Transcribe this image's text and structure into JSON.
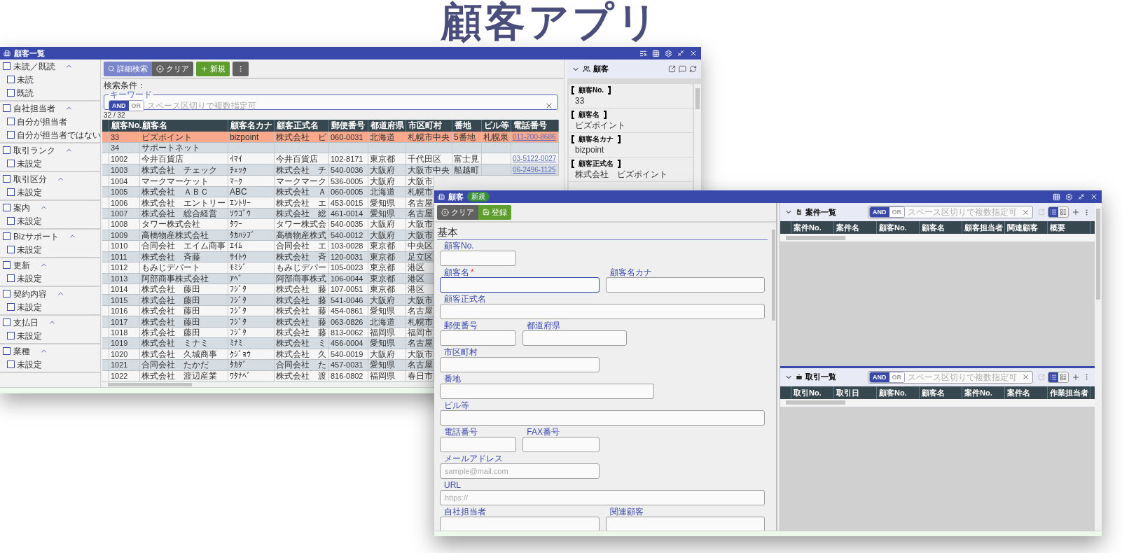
{
  "app_title": "顧客アプリ",
  "list_window": {
    "title": "顧客一覧",
    "filters": [
      {
        "label": "未読／既読",
        "checked": false,
        "expanded": true,
        "children": [
          {
            "label": "未読",
            "checked": false
          },
          {
            "label": "既読",
            "checked": false
          }
        ]
      },
      {
        "label": "自社担当者",
        "checked": false,
        "expanded": true,
        "children": [
          {
            "label": "自分が担当者",
            "checked": false
          },
          {
            "label": "自分が担当者ではない",
            "checked": false
          }
        ]
      },
      {
        "label": "取引ランク",
        "checked": false,
        "expanded": true,
        "children": [
          {
            "label": "未設定",
            "checked": false
          }
        ]
      },
      {
        "label": "取引区分",
        "checked": false,
        "expanded": true,
        "children": [
          {
            "label": "未設定",
            "checked": false
          }
        ]
      },
      {
        "label": "案内",
        "checked": false,
        "expanded": true,
        "children": [
          {
            "label": "未設定",
            "checked": false
          }
        ]
      },
      {
        "label": "Bizサポート",
        "checked": false,
        "expanded": true,
        "children": [
          {
            "label": "未設定",
            "checked": false
          }
        ]
      },
      {
        "label": "更新",
        "checked": false,
        "expanded": true,
        "children": [
          {
            "label": "未設定",
            "checked": false
          }
        ]
      },
      {
        "label": "契約内容",
        "checked": false,
        "expanded": true,
        "children": [
          {
            "label": "未設定",
            "checked": false
          }
        ]
      },
      {
        "label": "支払日",
        "checked": false,
        "expanded": true,
        "children": [
          {
            "label": "未設定",
            "checked": false
          }
        ]
      },
      {
        "label": "業種",
        "checked": false,
        "expanded": true,
        "children": [
          {
            "label": "未設定",
            "checked": false
          }
        ]
      }
    ],
    "toolbar": [
      {
        "kind": "search",
        "label": "詳細検索"
      },
      {
        "kind": "clear",
        "label": "クリア"
      },
      {
        "kind": "new",
        "label": "新規"
      },
      {
        "kind": "more"
      }
    ],
    "search_caption": "検索条件：",
    "keyword": {
      "legend": "キーワード",
      "modes": [
        {
          "label": "AND",
          "selected": true
        },
        {
          "label": "OR",
          "selected": false
        }
      ],
      "placeholder": "スペース区切りで複数指定可"
    },
    "count": "32 / 32",
    "table": {
      "columns": [
        "顧客No.",
        "顧客名",
        "顧客名カナ",
        "顧客正式名",
        "郵便番号",
        "都道府県",
        "市区町村",
        "番地",
        "ビル等",
        "電話番号"
      ],
      "rows": [
        {
          "selected": true,
          "cells": [
            "33",
            "ビズポイント",
            "bizpoint",
            "株式会社　ビ",
            "060-0031",
            "北海道",
            "札幌市中央",
            "5番地",
            "札幌泉",
            "011-200-8686"
          ]
        },
        {
          "selected": false,
          "cells": [
            "34",
            "サポートネット"
          ]
        },
        {
          "selected": false,
          "cells": [
            "1002",
            "今井百貨店",
            "ｲﾏｲ",
            "今井百貨店",
            "102-8171",
            "東京都",
            "千代田区",
            "富士見",
            null,
            "03-5122-0027"
          ]
        },
        {
          "selected": false,
          "cells": [
            "1003",
            "株式会社　チェック",
            "ﾁｪｯｸ",
            "株式会社　チ",
            "540-0036",
            "大阪府",
            "大阪市中央",
            "船越町",
            null,
            "06-2496-1125"
          ]
        },
        {
          "selected": false,
          "cells": [
            "1004",
            "マークマーケット",
            "ﾏｰｸ",
            "マークマーク",
            "536-0005",
            "大阪府",
            "大阪市"
          ]
        },
        {
          "selected": false,
          "cells": [
            "1005",
            "株式会社　ＡＢＣ",
            "ABC",
            "株式会社　Ａ",
            "060-0005",
            "北海道",
            "札幌市"
          ]
        },
        {
          "selected": false,
          "cells": [
            "1006",
            "株式会社　エントリー",
            "ｴﾝﾄﾘｰ",
            "株式会社　エ",
            "453-0015",
            "愛知県",
            "名古屋"
          ]
        },
        {
          "selected": false,
          "cells": [
            "1007",
            "株式会社　総合経営",
            "ｿｳｺﾞｳ",
            "株式会社　総",
            "461-0014",
            "愛知県",
            "名古屋"
          ]
        },
        {
          "selected": false,
          "cells": [
            "1008",
            "タワー株式会社",
            "ﾀﾜｰ",
            "タワー株式会",
            "540-0035",
            "大阪府",
            "大阪市"
          ]
        },
        {
          "selected": false,
          "cells": [
            "1009",
            "高橋物産株式会社",
            "ﾀｶﾊｼﾌﾞ",
            "高橋物産株式",
            "540-0012",
            "大阪府",
            "大阪市"
          ]
        },
        {
          "selected": false,
          "cells": [
            "1010",
            "合同会社　エイム商事",
            "ｴｲﾑ",
            "合同会社　エ",
            "103-0028",
            "東京都",
            "中央区"
          ]
        },
        {
          "selected": false,
          "cells": [
            "1011",
            "株式会社　斉藤",
            "ｻｲﾄｳ",
            "株式会社　斉",
            "120-0031",
            "東京都",
            "足立区"
          ]
        },
        {
          "selected": false,
          "cells": [
            "1012",
            "もみじデパート",
            "ﾓﾐｼﾞ",
            "もみじデパー",
            "105-0023",
            "東京都",
            "港区"
          ]
        },
        {
          "selected": false,
          "cells": [
            "1013",
            "阿部商事株式会社",
            "ｱﾍﾞ",
            "阿部商事株式",
            "106-0044",
            "東京都",
            "港区"
          ]
        },
        {
          "selected": false,
          "cells": [
            "1014",
            "株式会社　藤田",
            "ﾌｼﾞﾀ",
            "株式会社　藤",
            "107-0051",
            "東京都",
            "港区"
          ]
        },
        {
          "selected": false,
          "cells": [
            "1015",
            "株式会社　藤田",
            "ﾌｼﾞﾀ",
            "株式会社　藤",
            "541-0046",
            "大阪府",
            "大阪市"
          ]
        },
        {
          "selected": false,
          "cells": [
            "1016",
            "株式会社　藤田",
            "ﾌｼﾞﾀ",
            "株式会社　藤",
            "454-0861",
            "愛知県",
            "名古屋"
          ]
        },
        {
          "selected": false,
          "cells": [
            "1017",
            "株式会社　藤田",
            "ﾌｼﾞﾀ",
            "株式会社　藤",
            "063-0826",
            "北海道",
            "札幌市"
          ]
        },
        {
          "selected": false,
          "cells": [
            "1018",
            "株式会社　藤田",
            "ﾌｼﾞﾀ",
            "株式会社　藤",
            "813-0062",
            "福岡県",
            "福岡市"
          ]
        },
        {
          "selected": false,
          "cells": [
            "1019",
            "株式会社　ミナミ",
            "ﾐﾅﾐ",
            "株式会社　ミ",
            "456-0004",
            "愛知県",
            "名古屋"
          ]
        },
        {
          "selected": false,
          "cells": [
            "1020",
            "株式会社　久城商事",
            "ｸｼﾞｮｳ",
            "株式会社　久",
            "540-0019",
            "大阪府",
            "大阪市"
          ]
        },
        {
          "selected": false,
          "cells": [
            "1021",
            "合同会社　たかだ",
            "ﾀｶﾀﾞ",
            "合同会社　た",
            "457-0031",
            "愛知県",
            "名古屋"
          ]
        },
        {
          "selected": false,
          "cells": [
            "1022",
            "株式会社　渡辺産業",
            "ﾜﾀﾅﾍﾞ",
            "株式会社　渡",
            "816-0802",
            "福岡県",
            "春日市"
          ]
        }
      ]
    },
    "detail": {
      "title": "顧客",
      "expanded": true,
      "fields": [
        {
          "label": "顧客No.",
          "value": "33"
        },
        {
          "label": "顧客名",
          "value": "ビズポイント"
        },
        {
          "label": "顧客名カナ",
          "value": "bizpoint"
        },
        {
          "label": "顧客正式名",
          "value": "株式会社　ビズポイント"
        }
      ]
    }
  },
  "form_window": {
    "title": "顧客",
    "badge": "新規",
    "toolbar": [
      {
        "kind": "clear",
        "label": "クリア"
      },
      {
        "kind": "save",
        "label": "登録"
      }
    ],
    "section": "基本",
    "rows": [
      [
        {
          "label": "顧客No.",
          "focused": false
        }
      ],
      [
        {
          "label": "顧客名",
          "mark": "*",
          "focused": true
        },
        {
          "label": "顧客名カナ",
          "focused": false
        }
      ],
      [
        {
          "label": "顧客正式名",
          "focused": false
        }
      ],
      [
        {
          "label": "郵便番号",
          "focused": false
        },
        {
          "label": "都道府県",
          "focused": false
        }
      ],
      [
        {
          "label": "市区町村",
          "focused": false
        }
      ],
      [
        {
          "label": "番地",
          "focused": false
        }
      ],
      [
        {
          "label": "ビル等",
          "focused": false
        }
      ],
      [
        {
          "label": "電話番号",
          "focused": false
        },
        {
          "label": "FAX番号",
          "focused": false
        }
      ],
      [
        {
          "label": "メールアドレス",
          "placeholder": "sample@mail.com",
          "focused": false
        }
      ],
      [
        {
          "label": "URL",
          "placeholder": "https://",
          "focused": false
        }
      ],
      [
        {
          "label": "自社担当者",
          "focused": false
        },
        {
          "label": "関連顧客",
          "focused": false
        }
      ]
    ],
    "panels": [
      {
        "title": "案件一覧",
        "kind": "document",
        "expanded": true,
        "modes": [
          {
            "label": "AND",
            "selected": true
          },
          {
            "label": "OR",
            "selected": false
          }
        ],
        "placeholder": "スペース区切りで複数指定可",
        "views": [
          {
            "kind": "list",
            "selected": true
          },
          {
            "kind": "detail",
            "selected": false
          }
        ],
        "columns": [
          "案件No.",
          "案件名",
          "顧客No.",
          "顧客名",
          "顧客担当者",
          "関連顧客",
          "概要"
        ]
      },
      {
        "title": "取引一覧",
        "kind": "briefcase",
        "expanded": true,
        "modes": [
          {
            "label": "AND",
            "selected": true
          },
          {
            "label": "OR",
            "selected": false
          }
        ],
        "placeholder": "スペース区切りで複数指定可",
        "views": [
          {
            "kind": "list",
            "selected": true
          },
          {
            "kind": "detail",
            "selected": false
          }
        ],
        "columns": [
          "取引No.",
          "取引日",
          "顧客No.",
          "顧客名",
          "案件No.",
          "案件名",
          "作業担当者"
        ]
      }
    ]
  }
}
